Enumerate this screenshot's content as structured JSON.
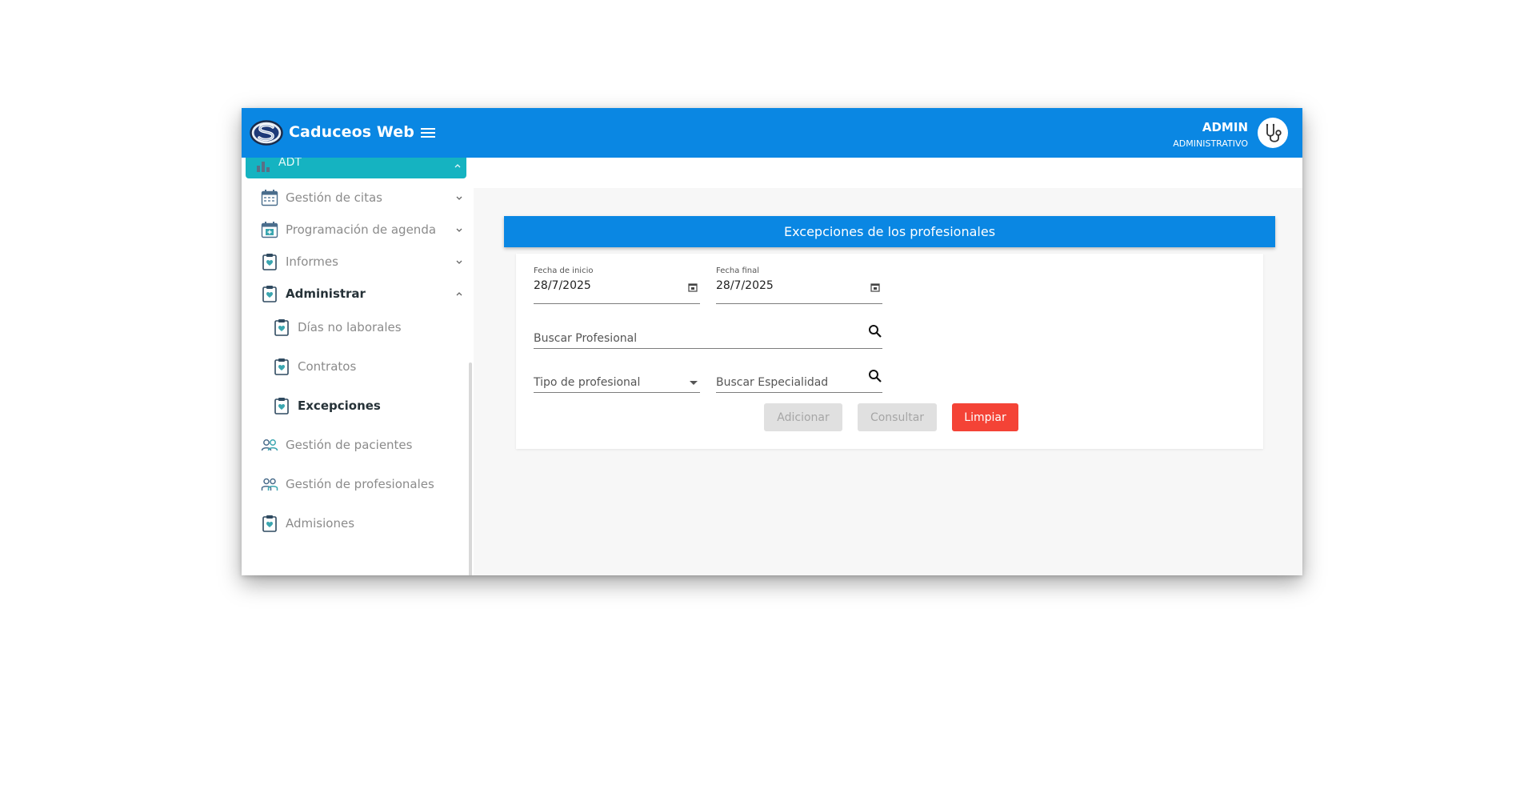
{
  "header": {
    "brand": "Caduceos Web",
    "user_name": "ADMIN",
    "user_role": "ADMINISTRATIVO",
    "logo_icon": "caduceos-s-logo",
    "menu_icon": "hamburger-menu-icon",
    "avatar_icon": "stethoscope-icon",
    "color": "#0a87e3"
  },
  "sidebar": {
    "active_group": {
      "label": "ADT",
      "icon": "chart-bar-icon",
      "color": "#15b3c1"
    },
    "items": [
      {
        "label": "Gestión de citas",
        "icon": "calendar-icon",
        "expandable": true
      },
      {
        "label": "Programación de agenda",
        "icon": "calendar-add-icon",
        "expandable": true
      },
      {
        "label": "Informes",
        "icon": "clipboard-icon",
        "expandable": true
      },
      {
        "label": "Administrar",
        "icon": "clipboard-icon",
        "expandable": true,
        "expanded": true
      },
      {
        "label": "Días no laborales",
        "icon": "clipboard-icon",
        "sub": true
      },
      {
        "label": "Contratos",
        "icon": "clipboard-icon",
        "sub": true
      },
      {
        "label": "Excepciones",
        "icon": "clipboard-icon",
        "sub": true,
        "selected": true
      },
      {
        "label": "Gestión de pacientes",
        "icon": "patients-icon"
      },
      {
        "label": "Gestión de profesionales",
        "icon": "professionals-icon"
      },
      {
        "label": "Admisiones",
        "icon": "clipboard-icon"
      }
    ]
  },
  "main": {
    "title": "Excepciones de los profesionales",
    "form": {
      "start_date": {
        "label": "Fecha de inicio",
        "value": "28/7/2025"
      },
      "end_date": {
        "label": "Fecha final",
        "value": "28/7/2025"
      },
      "search_professional": {
        "placeholder": "Buscar Profesional"
      },
      "professional_type": {
        "placeholder": "Tipo de profesional"
      },
      "search_specialty": {
        "placeholder": "Buscar Especialidad"
      }
    },
    "buttons": {
      "add": "Adicionar",
      "query": "Consultar",
      "clear": "Limpiar"
    },
    "colors": {
      "accent": "#0a87e3",
      "danger": "#f44336"
    }
  }
}
